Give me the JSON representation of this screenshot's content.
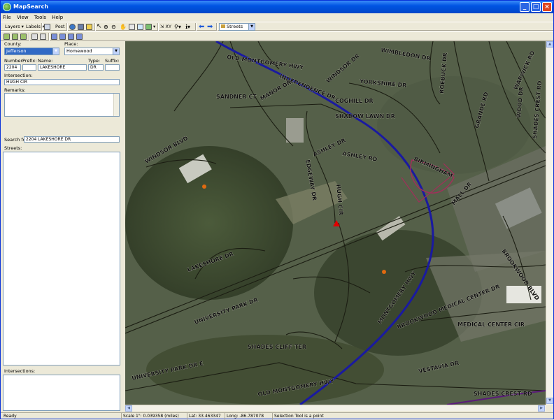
{
  "window": {
    "title": "MapSearch"
  },
  "menu": [
    "File",
    "View",
    "Tools",
    "Help"
  ],
  "toolbar1": {
    "layers_label": "Layers",
    "labels_label": "Labels",
    "post_label": "Post",
    "xy_label": "XY",
    "layer_select": "Streets"
  },
  "search_panel": {
    "county_label": "County:",
    "county_value": "Jefferson",
    "place_label": "Place:",
    "place_value": "Homewood",
    "number_label": "Number:",
    "prefix_label": "Prefix:",
    "name_label": "Name:",
    "type_label": "Type:",
    "suffix_label": "Suffix:",
    "number_value": "2204",
    "prefix_value": "",
    "name_value": "LAKESHORE",
    "type_value": "DR",
    "suffix_value": "",
    "intersection_label": "Intersection:",
    "intersection_value": "HUGH CIR",
    "remarks_label": "Remarks:",
    "search_for_label": "Search for:",
    "search_for_value": "2204 LAKESHORE DR",
    "streets_label": "Streets:",
    "intersections_label": "Intersections:"
  },
  "map_labels": [
    "OLD MONTGOMERY HWY",
    "INDEPENDENCE DR",
    "YORKSHIRE DR",
    "WIMBLEDON DR",
    "WINDSOR DR",
    "ROEBUCK DR",
    "COGHILL DR",
    "SANDNER CT",
    "MANOR DR",
    "SHADOW LAWN DR",
    "ASHLEY DR",
    "ASHLEY RD",
    "BIRMINGHAM",
    "GRANDE RD",
    "WOOD DR",
    "WARWICK RD",
    "SHADES CREST RD",
    "WINDSOR BLVD",
    "EDGEWAY DR",
    "HUGH CIR",
    "LAKESHORE DR",
    "UNIVERSITY PARK DR",
    "MONTGOMERY HWY",
    "BROOKWOOD MEDICAL CENTER DR",
    "MEDICAL CENTER CIR",
    "SHADES CLIFF TER",
    "UNIVERSITY PARK DR E",
    "OLD MONTGOMERY HWY",
    "VESTAVIA DR",
    "SHADES CREST RD",
    "BROOKWOOD BLVD",
    "MALL DR"
  ],
  "status": {
    "ready": "Ready",
    "scale": "Scale 1\": 0.039358 (miles)",
    "lat": "Lat: 33.463347",
    "long": "Long: -86.787078",
    "tool": "Selection Tool is a point"
  },
  "colors": {
    "route_blue": "#1a1aa0",
    "interchange_pink": "#a0305a",
    "marker_red": "#e00000",
    "marker_orange": "#e06a10",
    "titlebar_blue": "#0054e3"
  }
}
